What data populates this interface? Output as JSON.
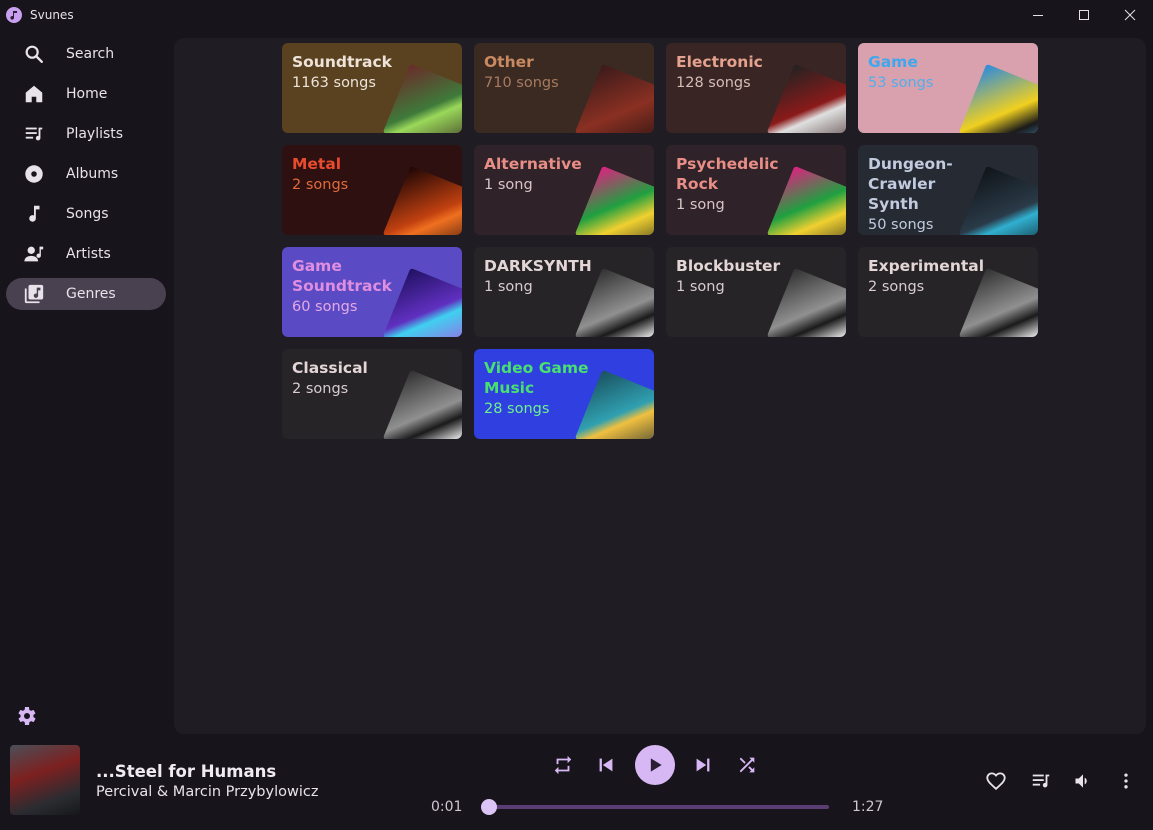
{
  "window": {
    "title": "Svunes"
  },
  "sidebar": {
    "items": [
      {
        "label": "Search",
        "icon": "search-icon"
      },
      {
        "label": "Home",
        "icon": "home-icon"
      },
      {
        "label": "Playlists",
        "icon": "playlist-icon"
      },
      {
        "label": "Albums",
        "icon": "album-icon"
      },
      {
        "label": "Songs",
        "icon": "music-note-icon"
      },
      {
        "label": "Artists",
        "icon": "artist-icon"
      },
      {
        "label": "Genres",
        "icon": "genres-icon",
        "active": true
      }
    ],
    "settings_icon": "gear-icon"
  },
  "genres": [
    {
      "name": "Soundtrack",
      "count": "1163 songs",
      "bg": "#5a4220",
      "fg": "#ede3d8",
      "count_fg": "#ede3d8"
    },
    {
      "name": "Other",
      "count": "710 songs",
      "bg": "#3a2a22",
      "fg": "#c98a62",
      "count_fg": "#a87a60"
    },
    {
      "name": "Electronic",
      "count": "128 songs",
      "bg": "#3a2525",
      "fg": "#e5a28e",
      "count_fg": "#d6bcb5"
    },
    {
      "name": "Game",
      "count": "53 songs",
      "bg": "#d9a0ae",
      "fg": "#3fa7ec",
      "count_fg": "#52aee8"
    },
    {
      "name": "Metal",
      "count": "2 songs",
      "bg": "#2e1010",
      "fg": "#e84b2d",
      "count_fg": "#e06a3a"
    },
    {
      "name": "Alternative",
      "count": "1 song",
      "bg": "#2f2228",
      "fg": "#e88e86",
      "count_fg": "#d9c5c8"
    },
    {
      "name": "Psychedelic Rock",
      "count": "1 song",
      "bg": "#2f2228",
      "fg": "#e88e86",
      "count_fg": "#d9c5c8"
    },
    {
      "name": "Dungeon-Crawler Synth",
      "count": "50 songs",
      "bg": "#262a33",
      "fg": "#c2ccde",
      "count_fg": "#c2ccde"
    },
    {
      "name": "Game Soundtrack",
      "count": "60 songs",
      "bg": "#5a4ac4",
      "fg": "#e08ee0",
      "count_fg": "#e6a8e6"
    },
    {
      "name": "DARKSYNTH",
      "count": "1 song",
      "bg": "#262427",
      "fg": "#e4d6d6",
      "count_fg": "#d8ccd0"
    },
    {
      "name": "Blockbuster",
      "count": "1 song",
      "bg": "#262427",
      "fg": "#e4d6d6",
      "count_fg": "#d8ccd0"
    },
    {
      "name": "Experimental",
      "count": "2 songs",
      "bg": "#262427",
      "fg": "#e4d6d6",
      "count_fg": "#d8ccd0"
    },
    {
      "name": "Classical",
      "count": "2 songs",
      "bg": "#262427",
      "fg": "#e4d6d6",
      "count_fg": "#d8ccd0"
    },
    {
      "name": "Video Game Music",
      "count": "28 songs",
      "bg": "#2f3fe0",
      "fg": "#48e070",
      "count_fg": "#6ff090"
    }
  ],
  "now_playing": {
    "title": "...Steel for Humans",
    "artist": "Percival & Marcin Przybylowicz",
    "elapsed": "0:01",
    "duration": "1:27",
    "progress": 0.012
  },
  "player_controls": {
    "repeat_icon": "repeat-icon",
    "previous_icon": "skip-previous-icon",
    "play_icon": "play-icon",
    "next_icon": "skip-next-icon",
    "shuffle_icon": "shuffle-icon",
    "favorite_icon": "heart-icon",
    "queue_icon": "queue-icon",
    "volume_icon": "volume-icon",
    "more_icon": "more-vertical-icon"
  },
  "colors": {
    "accent": "#d8b8f4",
    "active_nav": "#4a4150",
    "panel": "#201c24",
    "background": "#17141b"
  }
}
